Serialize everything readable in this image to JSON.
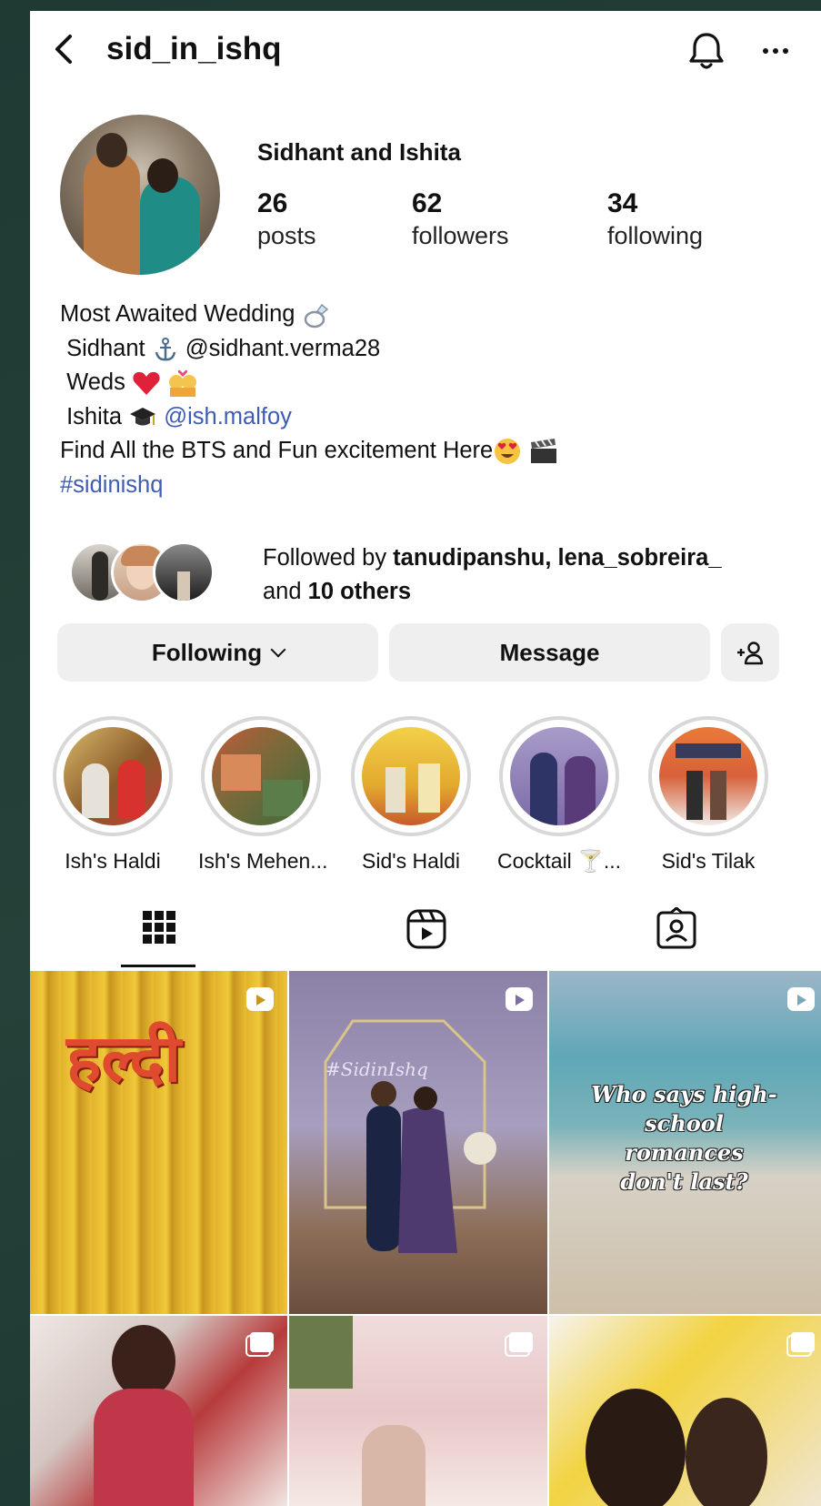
{
  "header": {
    "username": "sid_in_ishq"
  },
  "profile": {
    "display_name": "Sidhant and Ishita",
    "stats": [
      {
        "num": "26",
        "label": "posts"
      },
      {
        "num": "62",
        "label": "followers"
      },
      {
        "num": "34",
        "label": "following"
      }
    ]
  },
  "bio": {
    "line1": "Most Awaited Wedding",
    "line2_a": "Sidhant",
    "line2_b": "@sidhant.verma28",
    "line3": "Weds",
    "line4_a": "Ishita",
    "line4_b": "@ish.malfoy",
    "line5": "Find All the BTS and Fun excitement Here",
    "hashtag": "#sidinishq"
  },
  "followed_by": {
    "prefix": "Followed by",
    "names": "tanudipanshu, lena_sobreira_",
    "and": "and",
    "others": "10 others"
  },
  "actions": {
    "following": "Following",
    "message": "Message"
  },
  "highlights": [
    {
      "label": "Ish's Haldi"
    },
    {
      "label": "Ish's Mehen..."
    },
    {
      "label": "Sid's Haldi"
    },
    {
      "label": "Cocktail 🍸..."
    },
    {
      "label": "Sid's Tilak"
    }
  ],
  "posts": {
    "haldi_text": "हल्दी",
    "romance_text": "Who says high-school romances don't last?"
  },
  "colors": {
    "link": "#3f5bb5",
    "button_bg": "#efefef",
    "background": "#1f3a33"
  }
}
